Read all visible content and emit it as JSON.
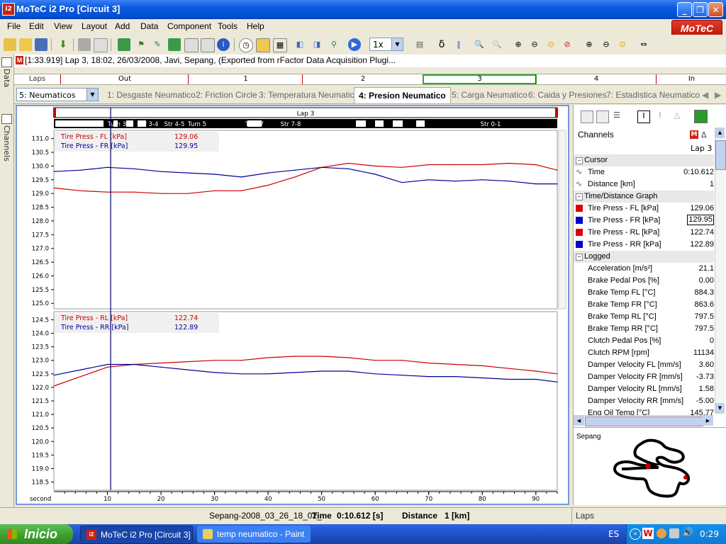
{
  "window": {
    "title": "MoTeC i2 Pro [Circuit 3]",
    "app_icon": "i2"
  },
  "menu": [
    "File",
    "Edit",
    "View",
    "Layout",
    "Add",
    "Data",
    "Component",
    "Tools",
    "Help"
  ],
  "logo": "MoTeC",
  "toolbar": {
    "zoom": "1x",
    "delta": "δ"
  },
  "dock": {
    "data_label": "Data",
    "channels_label": "Channels"
  },
  "info_line": "[1:33.919] Lap 3, 18:02, 26/03/2008, Javi, Sepang, (Exported from rFactor Data Acquisition Plugi...",
  "laps_bar": {
    "label": "Laps",
    "cells": [
      "Out",
      "1",
      "2",
      "3",
      "4",
      "In"
    ]
  },
  "worksheet_select": "5: Neumaticos",
  "tabs": [
    "1: Desgaste Neumatico",
    "2: Friction Circle",
    "3: Temperatura Neumatico",
    "4: Presion Neumatico",
    "5: Carga Neumatico",
    "6: Caida y Presiones",
    "7: Estadistica Neumatico"
  ],
  "active_tab": 3,
  "graph": {
    "lap_label": "Lap 3",
    "sections": [
      "Turn 3",
      "Str 3-4",
      "Str 4-5",
      "Turn 5",
      "Turn 7",
      "Str 7-8",
      "Str 0-1"
    ],
    "x_label": "second",
    "x_ticks": [
      10,
      20,
      30,
      40,
      50,
      60,
      70,
      80,
      90
    ],
    "cursor_x": 10.6,
    "top": {
      "y_ticks": [
        "131.0",
        "130.5",
        "130.0",
        "129.5",
        "129.0",
        "128.5",
        "128.0",
        "127.5",
        "127.0",
        "126.5",
        "126.0",
        "125.5",
        "125.0"
      ],
      "legend": [
        {
          "name": "Tire Press - FL [kPa]",
          "value": "129.06",
          "color": "#cc0000"
        },
        {
          "name": "Tire Press - FR [kPa]",
          "value": "129.95",
          "color": "#000099"
        }
      ]
    },
    "bottom": {
      "y_ticks": [
        "124.5",
        "124.0",
        "123.5",
        "123.0",
        "122.5",
        "122.0",
        "121.5",
        "121.0",
        "120.5",
        "120.0",
        "119.5",
        "119.0",
        "118.5"
      ],
      "legend": [
        {
          "name": "Tire Press - RL [kPa]",
          "value": "122.74",
          "color": "#cc0000"
        },
        {
          "name": "Tire Press - RR [kPa]",
          "value": "122.89",
          "color": "#000099"
        }
      ]
    }
  },
  "chart_data": {
    "type": "line",
    "x_unit": "second",
    "xlim": [
      0,
      94
    ],
    "top_ylim": [
      124.8,
      131.3
    ],
    "bottom_ylim": [
      118.2,
      124.8
    ],
    "series": [
      {
        "name": "Tire Press - FL [kPa]",
        "panel": "top",
        "color": "#cc0000",
        "x": [
          0,
          5,
          10,
          15,
          20,
          25,
          30,
          35,
          40,
          45,
          50,
          55,
          60,
          65,
          70,
          75,
          80,
          85,
          90,
          94
        ],
        "y": [
          129.2,
          129.1,
          129.05,
          129.05,
          129.0,
          129.0,
          129.1,
          129.1,
          129.3,
          129.6,
          129.95,
          130.1,
          130.0,
          129.95,
          130.05,
          130.05,
          130.05,
          130.1,
          130.05,
          129.85
        ]
      },
      {
        "name": "Tire Press - FR [kPa]",
        "panel": "top",
        "color": "#000099",
        "x": [
          0,
          5,
          10,
          15,
          20,
          25,
          30,
          35,
          40,
          45,
          50,
          55,
          60,
          65,
          70,
          75,
          80,
          85,
          90,
          94
        ],
        "y": [
          129.8,
          129.85,
          129.95,
          129.9,
          129.8,
          129.75,
          129.7,
          129.6,
          129.75,
          129.85,
          129.95,
          129.9,
          129.7,
          129.4,
          129.5,
          129.45,
          129.5,
          129.45,
          129.35,
          129.35
        ]
      },
      {
        "name": "Tire Press - RL [kPa]",
        "panel": "bottom",
        "color": "#cc0000",
        "x": [
          0,
          5,
          10,
          15,
          20,
          25,
          30,
          35,
          40,
          45,
          50,
          55,
          60,
          65,
          70,
          75,
          80,
          85,
          90,
          94
        ],
        "y": [
          122.05,
          122.4,
          122.75,
          122.85,
          122.9,
          122.95,
          123.0,
          123.0,
          123.1,
          123.15,
          123.15,
          123.1,
          123.0,
          123.0,
          122.9,
          122.85,
          122.8,
          122.7,
          122.6,
          122.5
        ]
      },
      {
        "name": "Tire Press - RR [kPa]",
        "panel": "bottom",
        "color": "#000099",
        "x": [
          0,
          5,
          10,
          15,
          20,
          25,
          30,
          35,
          40,
          45,
          50,
          55,
          60,
          65,
          70,
          75,
          80,
          85,
          90,
          94
        ],
        "y": [
          122.45,
          122.65,
          122.85,
          122.85,
          122.75,
          122.65,
          122.55,
          122.5,
          122.5,
          122.55,
          122.6,
          122.6,
          122.5,
          122.45,
          122.4,
          122.4,
          122.35,
          122.3,
          122.3,
          122.2
        ]
      }
    ]
  },
  "right_panel": {
    "header": "Channels",
    "lap": "Lap 3",
    "groups": [
      {
        "title": "Cursor",
        "items": [
          {
            "label": "Time",
            "value": "0:10.612",
            "icon": "wave"
          },
          {
            "label": "Distance [km]",
            "value": "1",
            "icon": "wave"
          }
        ]
      },
      {
        "title": "Time/Distance Graph",
        "items": [
          {
            "label": "Tire Press - FL [kPa]",
            "value": "129.06",
            "color": "#dd0000"
          },
          {
            "label": "Tire Press - FR [kPa]",
            "value": "129.95",
            "color": "#0000cc",
            "boxed": true
          },
          {
            "label": "Tire Press - RL [kPa]",
            "value": "122.74",
            "color": "#dd0000"
          },
          {
            "label": "Tire Press - RR [kPa]",
            "value": "122.89",
            "color": "#0000cc"
          }
        ]
      },
      {
        "title": "Logged",
        "items": [
          {
            "label": "Acceleration [m/s²]",
            "value": "21.1"
          },
          {
            "label": "Brake Pedal Pos [%]",
            "value": "0.00"
          },
          {
            "label": "Brake Temp FL [°C]",
            "value": "884.3"
          },
          {
            "label": "Brake Temp FR [°C]",
            "value": "863.6"
          },
          {
            "label": "Brake Temp RL [°C]",
            "value": "797.5"
          },
          {
            "label": "Brake Temp RR [°C]",
            "value": "797.5"
          },
          {
            "label": "Clutch Pedal Pos [%]",
            "value": "0"
          },
          {
            "label": "Clutch RPM [rpm]",
            "value": "11134"
          },
          {
            "label": "Damper Velocity FL [mm/s]",
            "value": "3.60"
          },
          {
            "label": "Damper Velocity FR [mm/s]",
            "value": "-3.73"
          },
          {
            "label": "Damper Velocity RL [mm/s]",
            "value": "1.58"
          },
          {
            "label": "Damper Velocity RR [mm/s]",
            "value": "-5.00"
          },
          {
            "label": "Eng Oil Temp [°C]",
            "value": "145.77"
          }
        ]
      }
    ],
    "track_name": "Sepang"
  },
  "status": {
    "file": "Sepang-2008_03_26_18_02_",
    "time_label": "Time",
    "time_value": "0:10.612 [s]",
    "distance_label": "Distance",
    "distance_value": "1 [km]",
    "laps": "Laps"
  },
  "taskbar": {
    "start": "Inicio",
    "tasks": [
      "MoTeC i2 Pro [Circuit 3]",
      "temp neumatico - Paint"
    ],
    "lang": "ES",
    "clock": "0:29"
  }
}
